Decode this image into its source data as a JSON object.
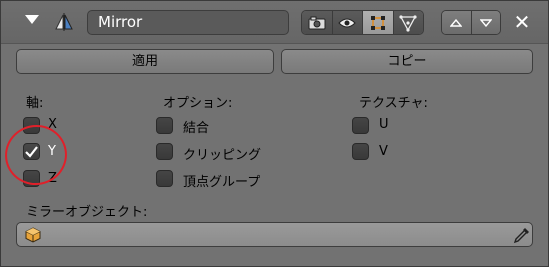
{
  "header": {
    "modifier_name": "Mirror",
    "icons": {
      "collapse": "triangle-down-icon",
      "modifier": "mirror-modifier-icon",
      "render": "camera-icon",
      "viewport": "eye-icon",
      "editmode": "edit-vertex-icon",
      "cage": "triangle-cage-icon",
      "move_up": "triangle-up-icon",
      "move_down": "triangle-down-icon",
      "remove": "close-icon"
    }
  },
  "buttons": {
    "apply": "適用",
    "copy": "コピー"
  },
  "axis": {
    "heading": "軸:",
    "items": [
      {
        "label": "X",
        "checked": false
      },
      {
        "label": "Y",
        "checked": true
      },
      {
        "label": "Z",
        "checked": false
      }
    ]
  },
  "options": {
    "heading": "オプション:",
    "items": [
      {
        "label": "結合",
        "checked": false
      },
      {
        "label": "クリッピング",
        "checked": false
      },
      {
        "label": "頂点グループ",
        "checked": false
      }
    ]
  },
  "texture": {
    "heading": "テクスチャ:",
    "items": [
      {
        "label": "U",
        "checked": false
      },
      {
        "label": "V",
        "checked": false
      }
    ]
  },
  "mirror_object": {
    "label": "ミラーオブジェクト:",
    "value": "",
    "icons": {
      "object": "cube-object-icon",
      "picker": "eyedropper-icon"
    }
  },
  "annotation_color": "#e0202a"
}
